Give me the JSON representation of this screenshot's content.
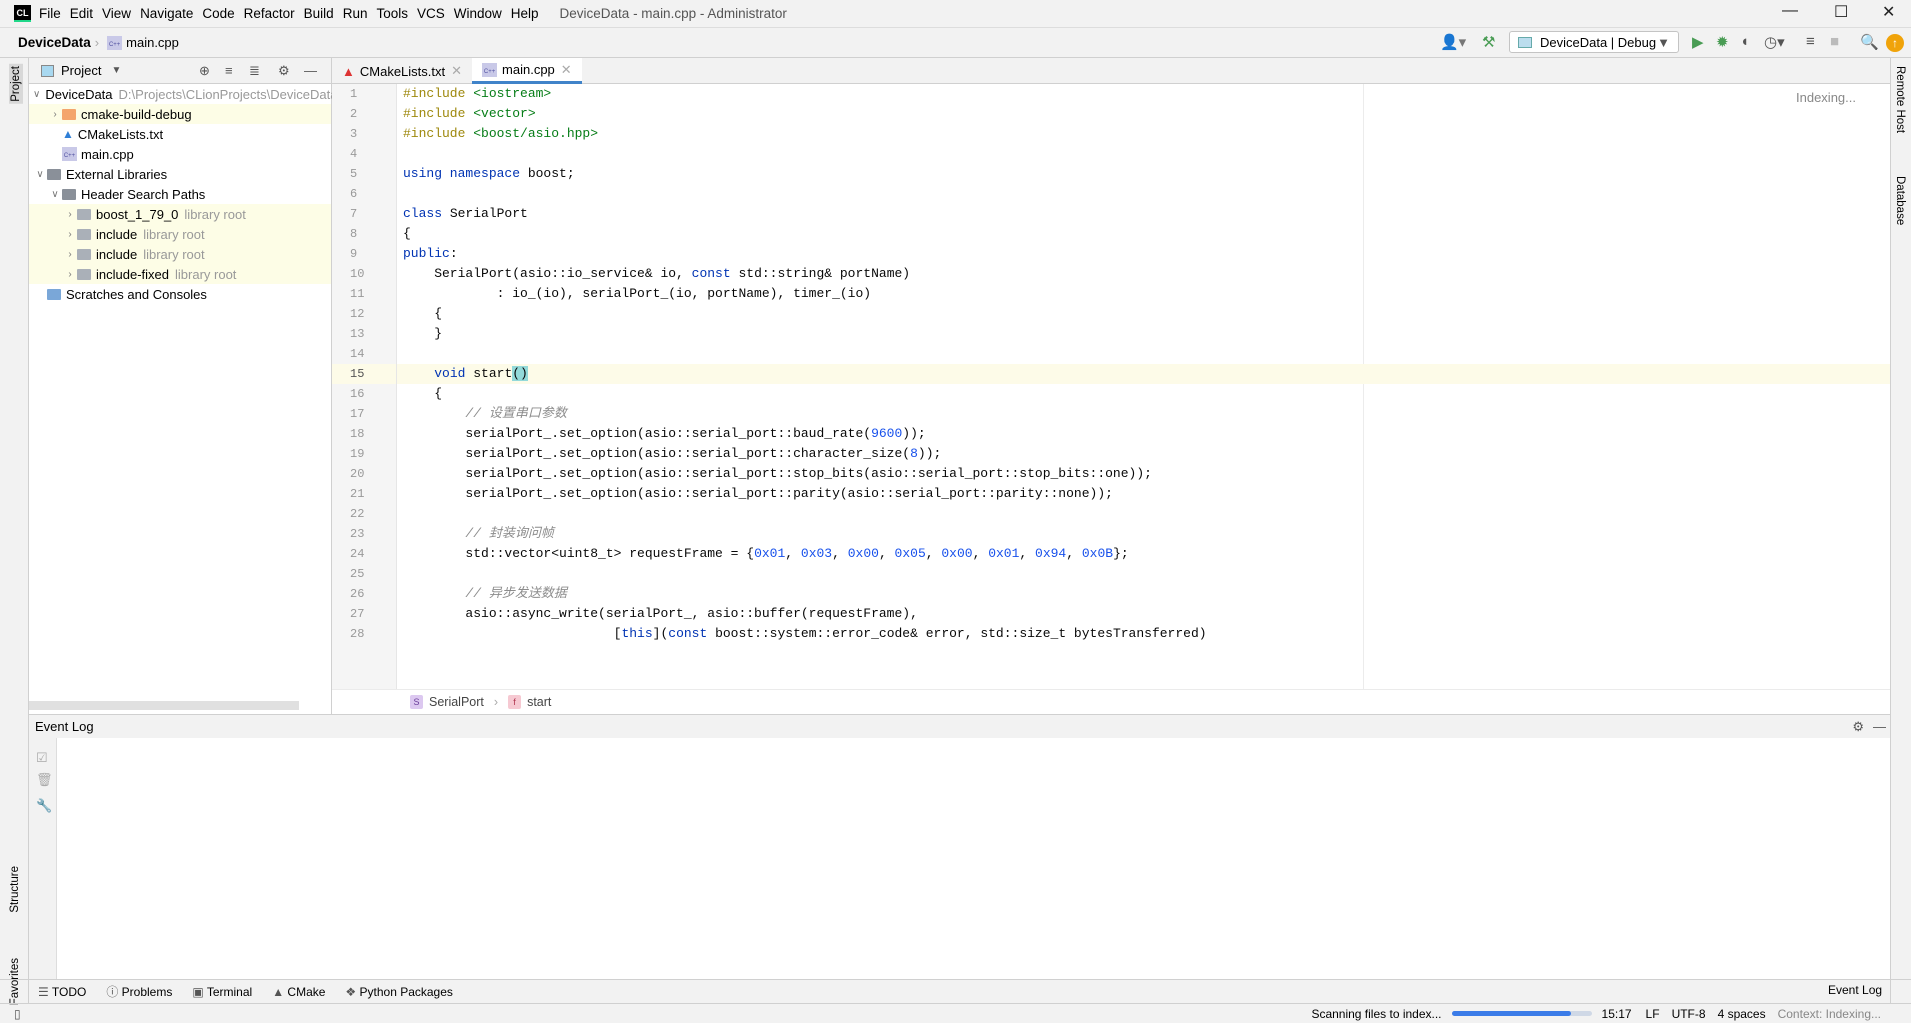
{
  "titlebar": {
    "logo": "CL",
    "menu": [
      "File",
      "Edit",
      "View",
      "Navigate",
      "Code",
      "Refactor",
      "Build",
      "Run",
      "Tools",
      "VCS",
      "Window",
      "Help"
    ],
    "title": "DeviceData - main.cpp - Administrator"
  },
  "navbar": {
    "project": "DeviceData",
    "file": "main.cpp",
    "run_config": "DeviceData | Debug"
  },
  "leftstrip": {
    "project": "Project",
    "structure": "Structure",
    "favorites": "Favorites"
  },
  "rightstrip": {
    "remote": "Remote Host",
    "database": "Database"
  },
  "project_panel": {
    "title": "Project",
    "tree": [
      {
        "label": "DeviceData",
        "extra": "D:\\Projects\\CLionProjects\\DeviceData",
        "depth": 0,
        "chev": "v",
        "icon": "folder-gray",
        "hl": false
      },
      {
        "label": "cmake-build-debug",
        "extra": "",
        "depth": 1,
        "chev": ">",
        "icon": "folder-orange",
        "hl": true
      },
      {
        "label": "CMakeLists.txt",
        "extra": "",
        "depth": 1,
        "chev": "",
        "icon": "cmake",
        "hl": false
      },
      {
        "label": "main.cpp",
        "extra": "",
        "depth": 1,
        "chev": "",
        "icon": "cpp",
        "hl": false
      },
      {
        "label": "External Libraries",
        "extra": "",
        "depth": 0,
        "chev": "v",
        "icon": "library",
        "hl": false
      },
      {
        "label": "Header Search Paths",
        "extra": "",
        "depth": 1,
        "chev": "v",
        "icon": "library",
        "hl": false
      },
      {
        "label": "boost_1_79_0",
        "extra": "library root",
        "depth": 2,
        "chev": ">",
        "icon": "folder-gray",
        "hl": true
      },
      {
        "label": "include",
        "extra": "library root",
        "depth": 2,
        "chev": ">",
        "icon": "folder-gray",
        "hl": true
      },
      {
        "label": "include",
        "extra": "library root",
        "depth": 2,
        "chev": ">",
        "icon": "folder-gray",
        "hl": true
      },
      {
        "label": "include-fixed",
        "extra": "library root",
        "depth": 2,
        "chev": ">",
        "icon": "folder-gray",
        "hl": true
      },
      {
        "label": "Scratches and Consoles",
        "extra": "",
        "depth": 0,
        "chev": "",
        "icon": "scratch",
        "hl": false
      }
    ]
  },
  "tabs": [
    {
      "label": "CMakeLists.txt",
      "active": false
    },
    {
      "label": "main.cpp",
      "active": true
    }
  ],
  "editor": {
    "indexing": "Indexing...",
    "current_line": 15,
    "lines": [
      [
        [
          "#include ",
          "pp"
        ],
        [
          "<iostream>",
          "str"
        ]
      ],
      [
        [
          "#include ",
          "pp"
        ],
        [
          "<vector>",
          "str"
        ]
      ],
      [
        [
          "#include ",
          "pp"
        ],
        [
          "<boost/asio.hpp>",
          "str"
        ]
      ],
      [],
      [
        [
          "using namespace ",
          "kw"
        ],
        [
          "boost;",
          ""
        ]
      ],
      [],
      [
        [
          "class ",
          "kw"
        ],
        [
          "SerialPort",
          ""
        ]
      ],
      [
        [
          "{",
          ""
        ]
      ],
      [
        [
          "public",
          "kw"
        ],
        [
          ":",
          ""
        ]
      ],
      [
        [
          "    SerialPort(asio::io_service& io, ",
          ""
        ],
        [
          "const ",
          "kw"
        ],
        [
          "std::string& portName)",
          ""
        ]
      ],
      [
        [
          "            : io_(io), serialPort_(io, portName), timer_(io)",
          ""
        ]
      ],
      [
        [
          "    {",
          ""
        ]
      ],
      [
        [
          "    }",
          ""
        ]
      ],
      [],
      [
        [
          "    ",
          ""
        ],
        [
          "void ",
          "kw"
        ],
        [
          "start",
          ""
        ],
        [
          "()",
          "brace"
        ]
      ],
      [
        [
          "    {",
          ""
        ]
      ],
      [
        [
          "        // 设置串口参数",
          "cm"
        ]
      ],
      [
        [
          "        serialPort_.set_option(asio::serial_port::baud_rate(",
          ""
        ],
        [
          "9600",
          "num"
        ],
        [
          "));",
          ""
        ]
      ],
      [
        [
          "        serialPort_.set_option(asio::serial_port::character_size(",
          ""
        ],
        [
          "8",
          "num"
        ],
        [
          "));",
          ""
        ]
      ],
      [
        [
          "        serialPort_.set_option(asio::serial_port::stop_bits(asio::serial_port::stop_bits::one));",
          ""
        ]
      ],
      [
        [
          "        serialPort_.set_option(asio::serial_port::parity(asio::serial_port::parity::none));",
          ""
        ]
      ],
      [],
      [
        [
          "        // 封装询问帧",
          "cm"
        ]
      ],
      [
        [
          "        std::vector<uint8_t> requestFrame = {",
          ""
        ],
        [
          "0x01",
          "num"
        ],
        [
          ", ",
          ""
        ],
        [
          "0x03",
          "num"
        ],
        [
          ", ",
          ""
        ],
        [
          "0x00",
          "num"
        ],
        [
          ", ",
          ""
        ],
        [
          "0x05",
          "num"
        ],
        [
          ", ",
          ""
        ],
        [
          "0x00",
          "num"
        ],
        [
          ", ",
          ""
        ],
        [
          "0x01",
          "num"
        ],
        [
          ", ",
          ""
        ],
        [
          "0x94",
          "num"
        ],
        [
          ", ",
          ""
        ],
        [
          "0x0B",
          "num"
        ],
        [
          "};",
          ""
        ]
      ],
      [],
      [
        [
          "        // 异步发送数据",
          "cm"
        ]
      ],
      [
        [
          "        asio::async_write(serialPort_, asio::buffer(requestFrame),",
          ""
        ]
      ],
      [
        [
          "                           [",
          ""
        ],
        [
          "this",
          "kw"
        ],
        [
          "](",
          ""
        ],
        [
          "const ",
          "kw"
        ],
        [
          "boost::system::error_code& error, std::size_t bytesTransferred)",
          ""
        ]
      ]
    ]
  },
  "breadcrumb": {
    "class": "SerialPort",
    "func": "start",
    "class_badge": "S",
    "func_badge": "f"
  },
  "event_log": {
    "title": "Event Log"
  },
  "toolwindows": [
    "TODO",
    "Problems",
    "Terminal",
    "CMake",
    "Python Packages"
  ],
  "event_log_button": "Event Log",
  "status": {
    "task": "Scanning files to index...",
    "progress": 0.85,
    "position": "15:17",
    "line_sep": "LF",
    "encoding": "UTF-8",
    "indent": "4 spaces",
    "context": "Context: Indexing..."
  },
  "colors": {
    "accent": "#4083c9",
    "run": "#499c54",
    "progress": "#3b7ce8"
  }
}
